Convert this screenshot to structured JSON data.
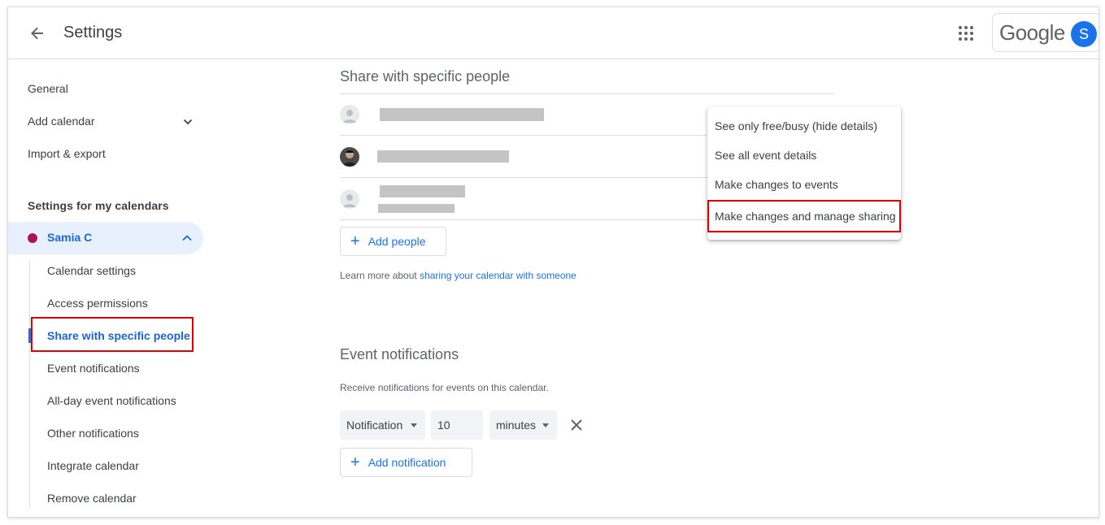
{
  "header": {
    "title": "Settings",
    "logo_text": "Google",
    "avatar_letter": "S"
  },
  "sidebar": {
    "general": "General",
    "add_calendar": "Add calendar",
    "import_export": "Import & export",
    "section_heading": "Settings for my calendars",
    "calendar_name": "Samia C",
    "calendar_color": "#ad1457",
    "sub_items": [
      "Calendar settings",
      "Access permissions",
      "Share with specific people",
      "Event notifications",
      "All-day event notifications",
      "Other notifications",
      "Integrate calendar",
      "Remove calendar"
    ]
  },
  "share": {
    "title": "Share with specific people",
    "add_people": "Add people",
    "learn_more_prefix": "Learn more about ",
    "learn_more_link": "sharing your calendar with someone"
  },
  "permission_menu": {
    "options": [
      "See only free/busy (hide details)",
      "See all event details",
      "Make changes to events",
      "Make changes and manage sharing"
    ],
    "highlighted": "Make changes and manage sharing"
  },
  "notifications": {
    "title": "Event notifications",
    "description": "Receive notifications for events on this calendar.",
    "type": "Notification",
    "amount": "10",
    "unit": "minutes",
    "add_label": "Add notification"
  },
  "colors": {
    "accent": "#1a73e8",
    "highlight_border": "#e00000"
  }
}
